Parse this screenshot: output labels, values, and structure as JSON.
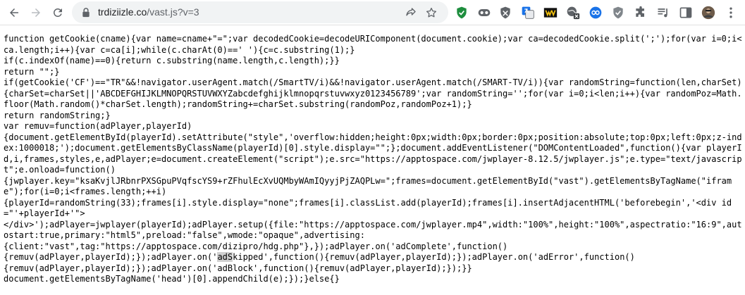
{
  "browser": {
    "url_host": "trdiziizle.co",
    "url_path": "/vast.js?v=3"
  },
  "code": {
    "before_highlight": "function getCookie(cname){var name=cname+\"=\";var decodedCookie=decodeURIComponent(document.cookie);var ca=decodedCookie.split(';');for(var i=0;i<ca.length;i++){var c=ca[i];while(c.charAt(0)==' '){c=c.substring(1);}\nif(c.indexOf(name)==0){return c.substring(name.length,c.length);}}\nreturn \"\";}\nif(getCookie('CF')==\"TR\"&&!navigator.userAgent.match(/SmartTV/i)&&!navigator.userAgent.match(/SMART-TV/i)){var randomString=function(len,charSet){charSet=charSet||'ABCDEFGHIJKLMNOPQRSTUVWXYZabcdefghijklmnopqrstuvwxyz0123456789';var randomString='';for(var i=0;i<len;i++){var randomPoz=Math.floor(Math.random()*charSet.length);randomString+=charSet.substring(randomPoz,randomPoz+1);}\nreturn randomString;}\nvar remuv=function(adPlayer,playerId)\n{document.getElementById(playerId).setAttribute(\"style\",'overflow:hidden;height:0px;width:0px;border:0px;position:absolute;top:0px;left:0px;z-index:1000018;');document.getElementsByClassName(playerId)[0].style.display=\"\";};document.addEventListener(\"DOMContentLoaded\",function(){var playerId,i,frames,styles,e,adPlayer;e=document.createElement(\"script\");e.src=\"https://apptospace.com/jwplayer-8.12.5/jwplayer.js\";e.type=\"text/javascript\";e.onload=function()\n{jwplayer.key=\"ksaKvjlJRbnrPXSGpuPVqfscYS9+rZFhulEcXvUQMbyWAmIQyyjPjZAQPLw=\";frames=document.getElementById(\"vast\").getElementsByTagName(\"iframe\");for(i=0;i<frames.length;++i)\n{playerId=randomString(33);frames[i].style.display=\"none\";frames[i].classList.add(playerId);frames[i].insertAdjacentHTML('beforebegin','<div id=\"'+playerId+'\">\n</div>');adPlayer=jwplayer(playerId);adPlayer.setup({file:\"https://apptospace.com/jwplayer.mp4\",width:\"100%\",height:\"100%\",aspectratio:\"16:9\",autostart:true,primary:\"html5\",preload:\"false\",wmode:\"opaque\",advertising:\n{client:\"vast\",tag:\"https://apptospace.com/dizipro/hdg.php\"},});adPlayer.on('adComplete',function()\n{remuv(adPlayer,playerId);});adPlayer.on('",
    "highlight": "adS",
    "after_highlight": "kipped',function(){remuv(adPlayer,playerId);});adPlayer.on('adError',function()\n{remuv(adPlayer,playerId);});adPlayer.on('adBlock',function(){remuv(adPlayer,playerId);});}}\ndocument.getElementsByTagName('head')[0].appendChild(e);});}else{}"
  },
  "colors": {
    "icon_gray": "#5f6368",
    "shield_green": "#1e8e3e",
    "translate_blue": "#1a73e8",
    "ext_yellow": "#f4c20d"
  }
}
